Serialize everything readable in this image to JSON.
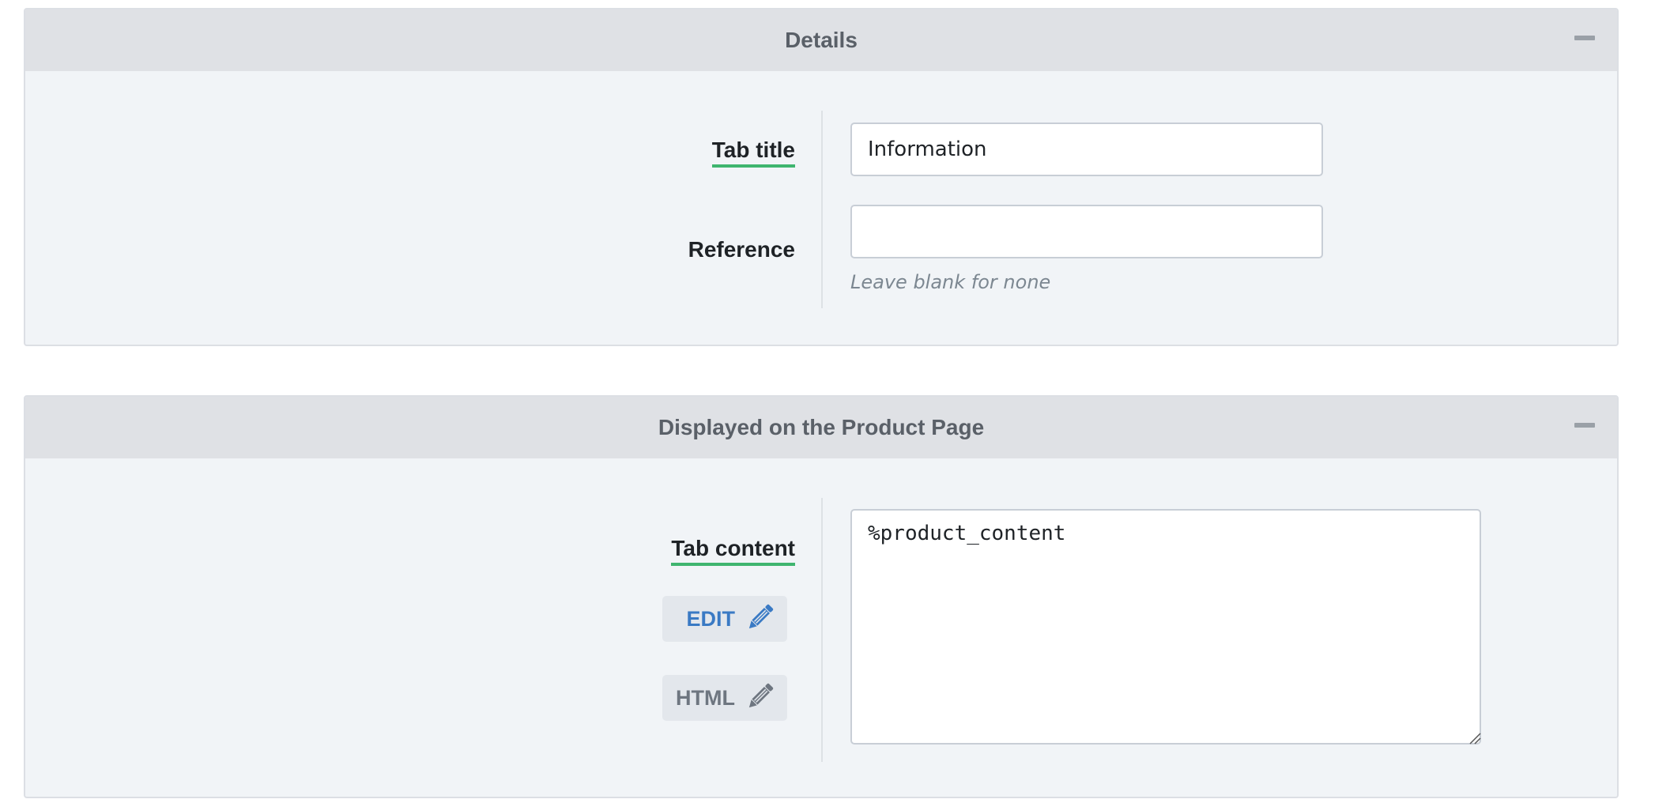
{
  "details_panel": {
    "title": "Details",
    "tab_title_label": "Tab title",
    "tab_title_value": "Information",
    "reference_label": "Reference",
    "reference_value": "",
    "reference_hint": "Leave blank for none"
  },
  "product_page_panel": {
    "title": "Displayed on the Product Page",
    "tab_content_label": "Tab content",
    "edit_button_label": "EDIT",
    "html_button_label": "HTML",
    "tab_content_value": "%product_content"
  },
  "icons": {
    "collapse": "minus-icon",
    "edit": "pencil-icon",
    "html": "pencil-icon"
  },
  "colors": {
    "required_underline": "#3fb56f",
    "edit_accent": "#3a7ac4",
    "header_bg": "#dfe1e5",
    "panel_bg": "#f1f4f7"
  }
}
